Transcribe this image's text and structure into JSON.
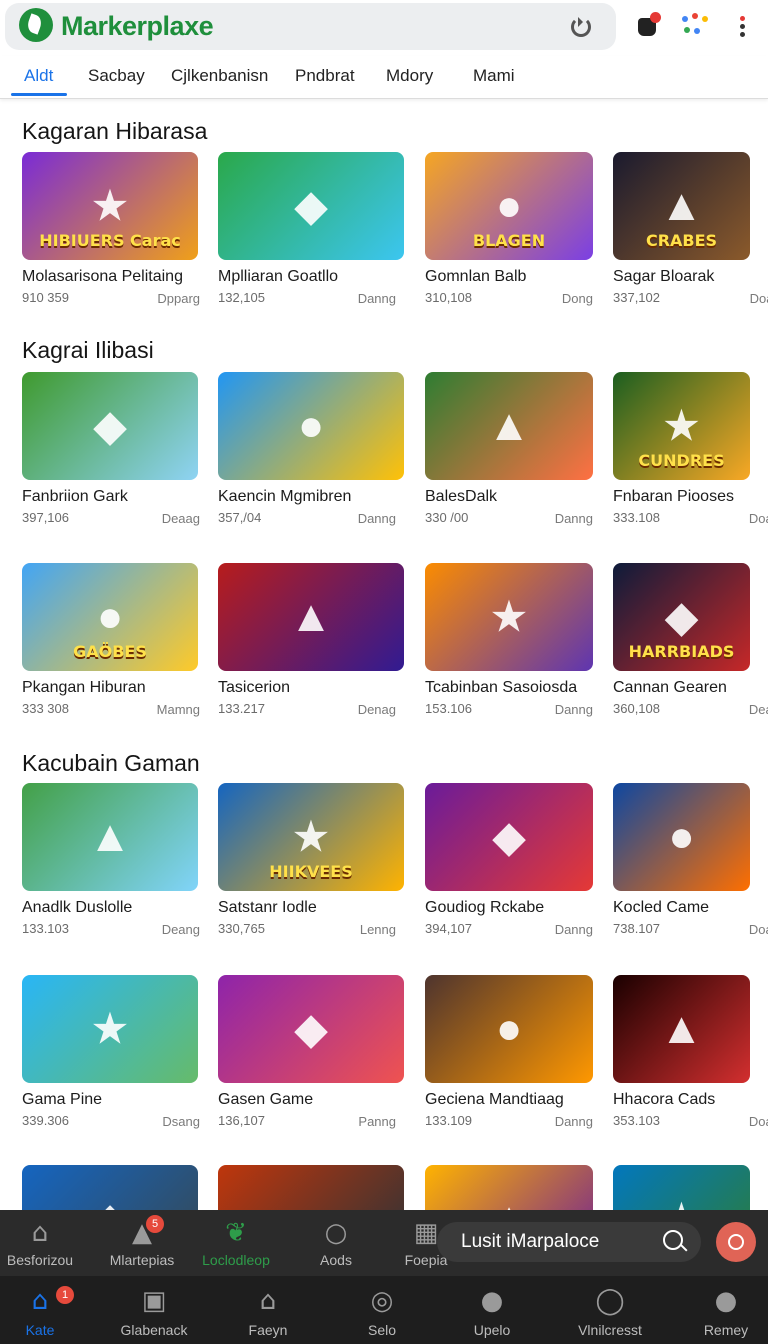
{
  "header": {
    "brand": "Markerplaxe",
    "icons": [
      "logo-leaf-icon",
      "reload-icon",
      "hand-icon",
      "apps-grid-icon",
      "more-vert-icon"
    ],
    "accent": "#1f8f3c"
  },
  "tabs": [
    "Aldt",
    "Sacbay",
    "Cjlkenbanisn",
    "Pndbrat",
    "Mdory",
    "Mami"
  ],
  "sections": [
    {
      "title": "Kagaran Hibarasa",
      "cards": [
        {
          "title": "Molasarisona Pelitaing",
          "count": "910 359",
          "tag": "Dpparg",
          "thumb_text": "HIBIUERS Carac",
          "colors": [
            "#7a2bd6",
            "#f0a019"
          ]
        },
        {
          "title": "Mplliaran Goatllo",
          "count": "132,105",
          "tag": "Danng",
          "thumb_text": "",
          "colors": [
            "#2aa84a",
            "#3cc6f0"
          ]
        },
        {
          "title": "Gomnlan Balb",
          "count": "310,108",
          "tag": "Dong",
          "thumb_text": "BLAGEN",
          "colors": [
            "#f5a623",
            "#7b3fe4"
          ]
        },
        {
          "title": "Sagar Bloarak",
          "count": "337,102",
          "tag": "Doay",
          "thumb_text": "CRABES",
          "colors": [
            "#1a1a2e",
            "#8b5a2b"
          ]
        }
      ]
    },
    {
      "title": "Kagrai Ilibasi",
      "cards": [
        {
          "title": "Fanbriion Gark",
          "count": "397,106",
          "tag": "Deaag",
          "thumb_text": "",
          "colors": [
            "#3f9a2e",
            "#8fd3f4"
          ]
        },
        {
          "title": "Kaencin Mgmibren",
          "count": "357,/04",
          "tag": "Danng",
          "thumb_text": "",
          "colors": [
            "#2196f3",
            "#ffc107"
          ]
        },
        {
          "title": "BalesDalk",
          "count": "330 /00",
          "tag": "Danng",
          "thumb_text": "",
          "colors": [
            "#2e7d32",
            "#ff7043"
          ]
        },
        {
          "title": "Fnbaran Piooses",
          "count": "333.108",
          "tag": "Doag",
          "thumb_text": "CUNDRES",
          "colors": [
            "#1b5e20",
            "#f9a825"
          ]
        }
      ]
    },
    {
      "title": "",
      "cards": [
        {
          "title": "Pkangan Hiburan",
          "count": "333 308",
          "tag": "Mamng",
          "thumb_text": "GAÖBES",
          "colors": [
            "#42a5f5",
            "#ffca28"
          ]
        },
        {
          "title": "Tasicerion",
          "count": "133.217",
          "tag": "Denag",
          "thumb_text": "",
          "colors": [
            "#b71c1c",
            "#311b92"
          ]
        },
        {
          "title": "Tcabinban Sasoiosda",
          "count": "153.106",
          "tag": "Danng",
          "thumb_text": "",
          "colors": [
            "#fb8c00",
            "#5e35b1"
          ]
        },
        {
          "title": "Cannan Gearen",
          "count": "360,108",
          "tag": "Deap",
          "thumb_text": "HARRBIADS",
          "colors": [
            "#0d1b3a",
            "#c62828"
          ]
        }
      ]
    },
    {
      "title": "Kacubain Gaman",
      "cards": [
        {
          "title": "Anadlk Duslolle",
          "count": "133.103",
          "tag": "Deang",
          "thumb_text": "",
          "colors": [
            "#43a047",
            "#81d4fa"
          ]
        },
        {
          "title": "Satstanr Iodle",
          "count": "330,765",
          "tag": "Lenng",
          "thumb_text": "HIIKVEES",
          "colors": [
            "#1565c0",
            "#ffb300"
          ]
        },
        {
          "title": "Goudiog Rckabe",
          "count": "394,107",
          "tag": "Danng",
          "thumb_text": "",
          "colors": [
            "#6a1b9a",
            "#e53935"
          ]
        },
        {
          "title": "Kocled Came",
          "count": "738.107",
          "tag": "Doag",
          "thumb_text": "",
          "colors": [
            "#0d47a1",
            "#ff6f00"
          ]
        }
      ]
    },
    {
      "title": "",
      "cards": [
        {
          "title": "Gama Pine",
          "count": "339.306",
          "tag": "Dsang",
          "thumb_text": "",
          "colors": [
            "#29b6f6",
            "#66bb6a"
          ]
        },
        {
          "title": "Gasen Game",
          "count": "136,107",
          "tag": "Panng",
          "thumb_text": "",
          "colors": [
            "#8e24aa",
            "#ef5350"
          ]
        },
        {
          "title": "Geciena Mandtiaag",
          "count": "133.109",
          "tag": "Danng",
          "thumb_text": "",
          "colors": [
            "#4e342e",
            "#ff9800"
          ]
        },
        {
          "title": "Hhacora Cads",
          "count": "353.103",
          "tag": "Doag",
          "thumb_text": "",
          "colors": [
            "#1a0000",
            "#d32f2f"
          ]
        }
      ]
    },
    {
      "title": "",
      "cards": [
        {
          "title": "",
          "count": "",
          "tag": "",
          "thumb_text": "",
          "colors": [
            "#1565c0",
            "#37474f"
          ]
        },
        {
          "title": "",
          "count": "",
          "tag": "",
          "thumb_text": "",
          "colors": [
            "#bf360c",
            "#263238"
          ]
        },
        {
          "title": "",
          "count": "",
          "tag": "",
          "thumb_text": "",
          "colors": [
            "#ffb300",
            "#6a1b9a"
          ]
        },
        {
          "title": "",
          "count": "",
          "tag": "",
          "thumb_text": "",
          "colors": [
            "#0277bd",
            "#2e7d32"
          ]
        }
      ]
    }
  ],
  "dock_upper": [
    {
      "label": "Besforizou",
      "icon": "home-icon",
      "glyph": "⌂",
      "badge": ""
    },
    {
      "label": "Mlartepias",
      "icon": "mountain-icon",
      "glyph": "▲",
      "badge": "5"
    },
    {
      "label": "Loclodleop",
      "icon": "leaf-icon",
      "glyph": "❦",
      "badge": "",
      "active": true
    },
    {
      "label": "Aods",
      "icon": "search-icon",
      "glyph": "○",
      "badge": ""
    },
    {
      "label": "Foepia",
      "icon": "grid-icon",
      "glyph": "▦",
      "badge": ""
    }
  ],
  "omnibox": {
    "label": "Lusit iMarpaloce"
  },
  "dock_lower": [
    {
      "label": "Kate",
      "icon": "home-icon",
      "glyph": "⌂",
      "badge": "1",
      "active": true
    },
    {
      "label": "Glabenack",
      "icon": "briefcase-icon",
      "glyph": "▣",
      "badge": ""
    },
    {
      "label": "Faeyn",
      "icon": "house-outline-icon",
      "glyph": "⌂",
      "badge": ""
    },
    {
      "label": "Selo",
      "icon": "target-icon",
      "glyph": "◎",
      "badge": ""
    },
    {
      "label": "Upelo",
      "icon": "chat-icon",
      "glyph": "●",
      "badge": ""
    },
    {
      "label": "Vlnilcresst",
      "icon": "search-icon",
      "glyph": "◯",
      "badge": ""
    },
    {
      "label": "Remey",
      "icon": "person-icon",
      "glyph": "●",
      "badge": ""
    }
  ],
  "colors": {
    "active_blue": "#1a73e8",
    "active_green": "#2e9d4a"
  }
}
